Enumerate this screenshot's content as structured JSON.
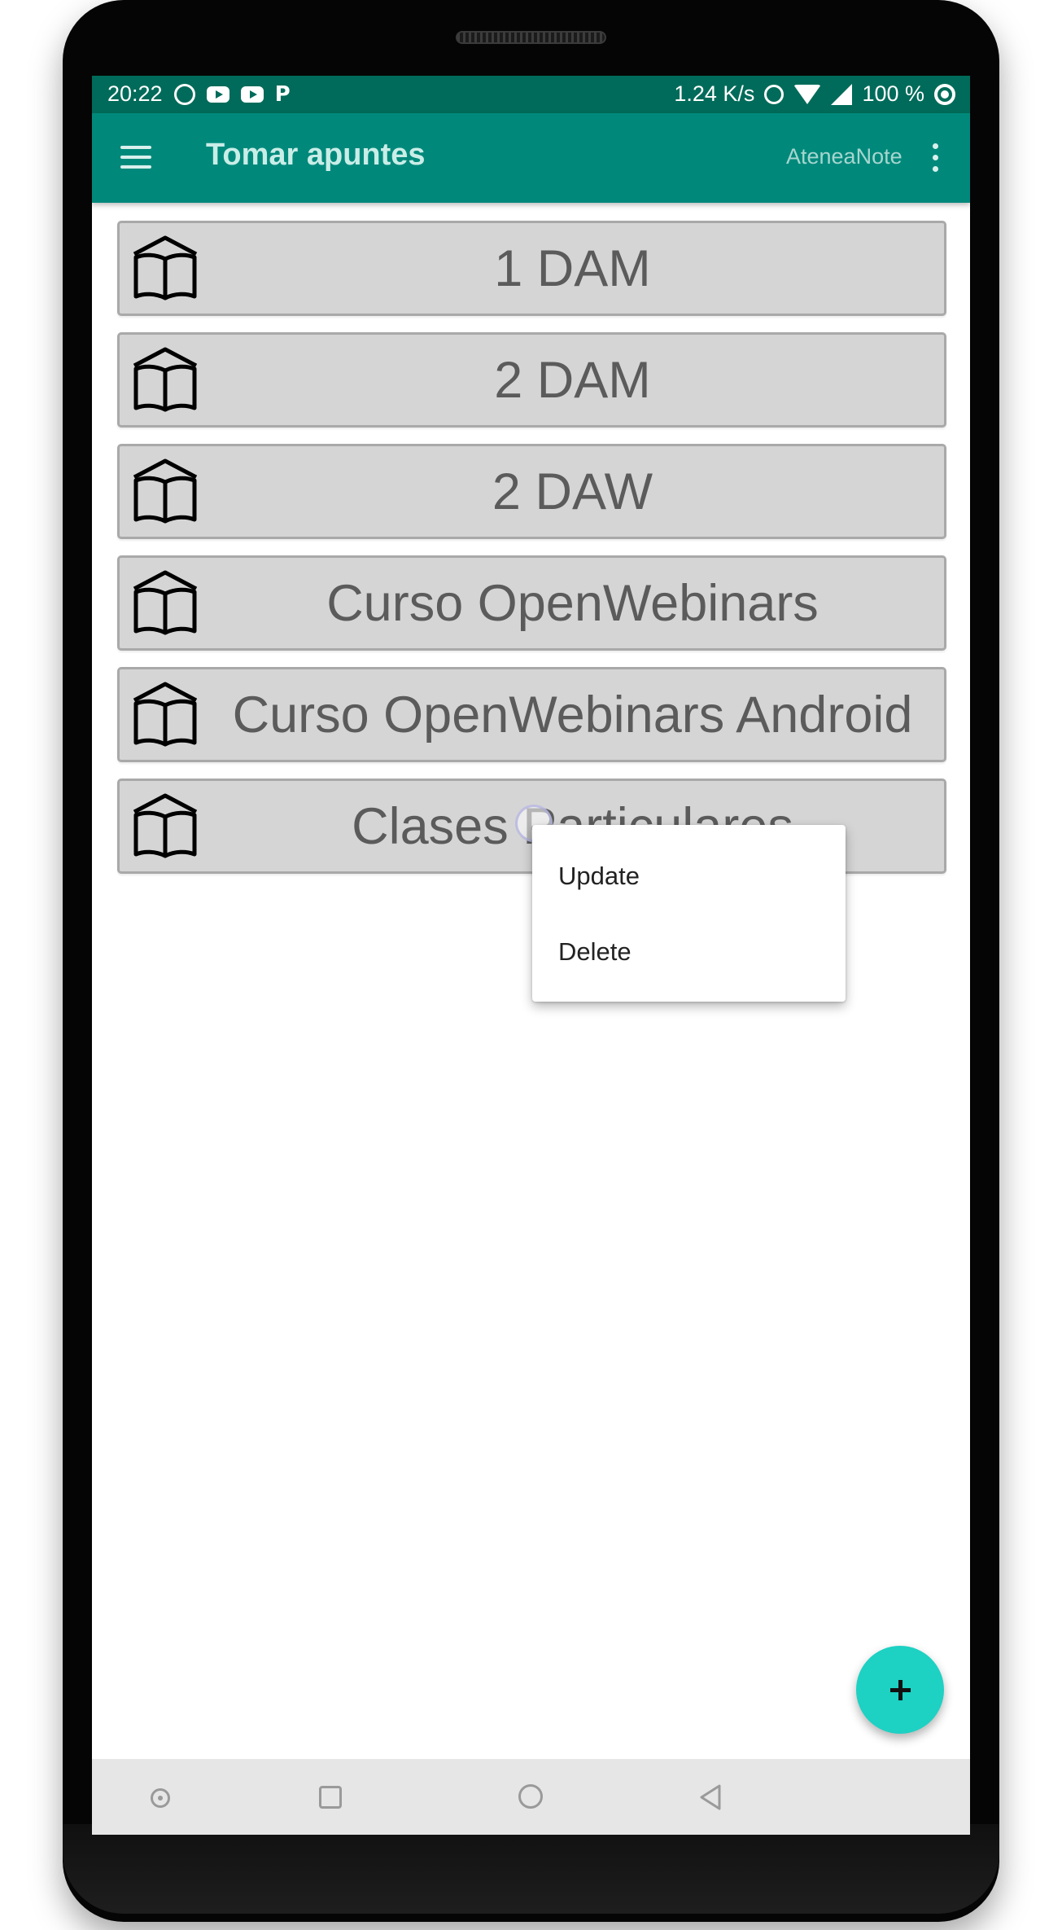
{
  "status_bar": {
    "time": "20:22",
    "network_speed": "1.24 K/s",
    "battery": "100 %",
    "left_icons": [
      "whatsapp-icon",
      "youtube-icon",
      "youtube-icon",
      "pocket-casts-icon"
    ],
    "right_icons": [
      "alarm-icon",
      "wifi-icon",
      "signal-icon",
      "sync-icon"
    ]
  },
  "app_bar": {
    "title": "Tomar apuntes",
    "action_label": "AteneaNote",
    "menu_icon": "hamburger-menu-icon",
    "overflow_icon": "more-vert-icon",
    "color": "#00897b"
  },
  "courses": [
    {
      "label": "1 DAM",
      "icon": "book-icon"
    },
    {
      "label": "2 DAM",
      "icon": "book-icon"
    },
    {
      "label": "2 DAW",
      "icon": "book-icon"
    },
    {
      "label": "Curso OpenWebinars",
      "icon": "book-icon"
    },
    {
      "label": "Curso OpenWebinars Android",
      "icon": "book-icon"
    },
    {
      "label": "Clases Particulares",
      "icon": "book-icon"
    }
  ],
  "context_menu": {
    "items": [
      {
        "label": "Update"
      },
      {
        "label": "Delete"
      }
    ]
  },
  "fab": {
    "icon": "plus-icon",
    "color": "#1dd1c3"
  },
  "nav_bar": {
    "buttons": [
      "assistant-icon",
      "recents-icon",
      "home-icon",
      "back-icon"
    ]
  }
}
